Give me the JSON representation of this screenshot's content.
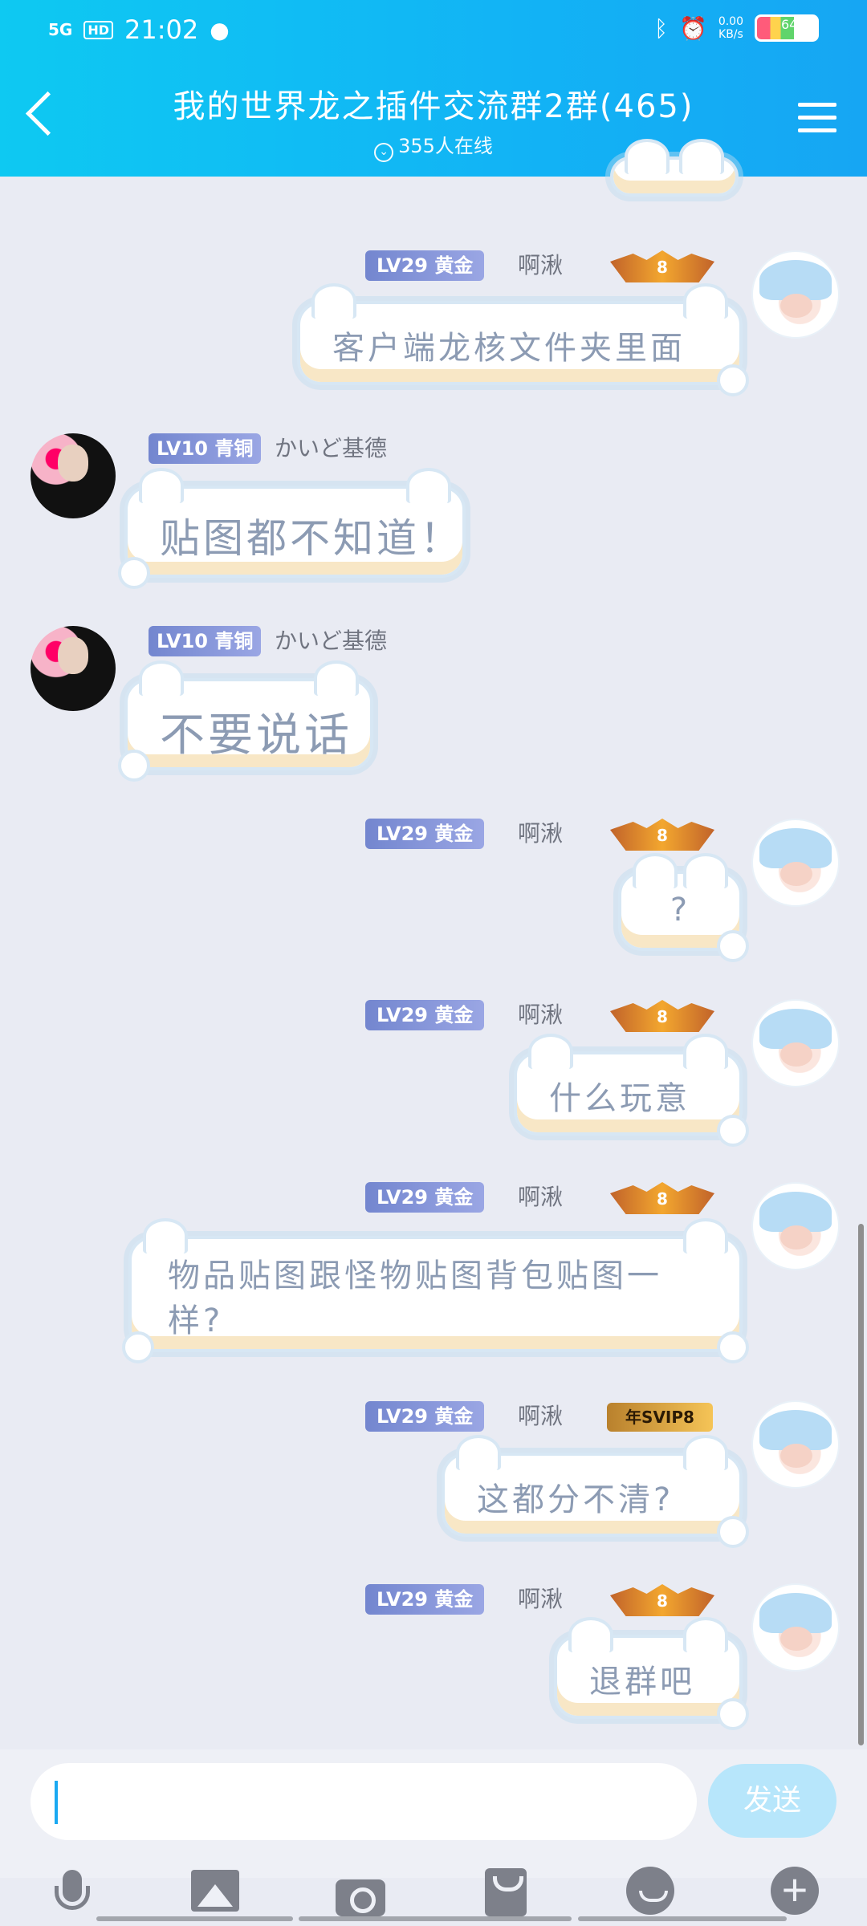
{
  "status": {
    "network": "5G",
    "hd": "HD",
    "time": "21:02",
    "speed_value": "0.00",
    "speed_unit": "KB/s",
    "battery": "64"
  },
  "header": {
    "title": "我的世界龙之插件交流群2群(465)",
    "online": "355人在线"
  },
  "messages": [
    {
      "side": "right",
      "level": "LV29",
      "rank": "黄金",
      "nick": "啊湫",
      "medal": "8",
      "text": "客户端龙核文件夹里面"
    },
    {
      "side": "left",
      "level": "LV10",
      "rank": "青铜",
      "nick": "かいど基德",
      "text": "贴图都不知道！"
    },
    {
      "side": "left",
      "level": "LV10",
      "rank": "青铜",
      "nick": "かいど基德",
      "text": "不要说话"
    },
    {
      "side": "right",
      "level": "LV29",
      "rank": "黄金",
      "nick": "啊湫",
      "medal": "8",
      "text": "?"
    },
    {
      "side": "right",
      "level": "LV29",
      "rank": "黄金",
      "nick": "啊湫",
      "medal": "8",
      "text": "什么玩意"
    },
    {
      "side": "right",
      "level": "LV29",
      "rank": "黄金",
      "nick": "啊湫",
      "medal": "8",
      "text": "物品贴图跟怪物贴图背包贴图一样?"
    },
    {
      "side": "right",
      "level": "LV29",
      "rank": "黄金",
      "nick": "啊湫",
      "medal": "年SVIP8",
      "text": "这都分不清?"
    },
    {
      "side": "right",
      "level": "LV29",
      "rank": "黄金",
      "nick": "啊湫",
      "medal": "8",
      "text": "退群吧"
    }
  ],
  "composer": {
    "send_label": "发送"
  },
  "icons": [
    "voice-icon",
    "image-icon",
    "camera-icon",
    "red-packet-icon",
    "emoji-icon",
    "plus-icon"
  ]
}
